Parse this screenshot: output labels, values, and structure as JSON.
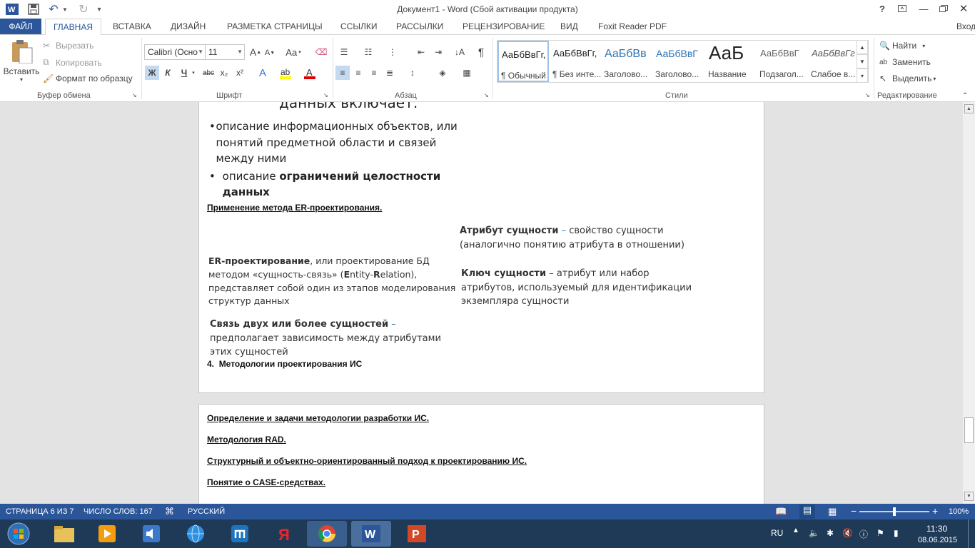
{
  "titlebar": {
    "title": "Документ1 - Word (Сбой активации продукта)",
    "help": "?",
    "user": "Вход"
  },
  "tabs": [
    "ФАЙЛ",
    "ГЛАВНАЯ",
    "ВСТАВКА",
    "ДИЗАЙН",
    "РАЗМЕТКА СТРАНИЦЫ",
    "ССЫЛКИ",
    "РАССЫЛКИ",
    "РЕЦЕНЗИРОВАНИЕ",
    "ВИД",
    "Foxit Reader PDF"
  ],
  "clipboard": {
    "paste": "Вставить",
    "cut": "Вырезать",
    "copy": "Копировать",
    "format_painter": "Формат по образцу",
    "group": "Буфер обмена"
  },
  "font": {
    "name": "Calibri (Осно",
    "size": "11",
    "group": "Шрифт",
    "bold": "Ж",
    "italic": "К",
    "underline": "Ч",
    "strike": "abc",
    "sub": "x₂",
    "sup": "x²",
    "case": "Аа"
  },
  "paragraph": {
    "group": "Абзац"
  },
  "styles": {
    "group": "Стили",
    "items": [
      {
        "preview": "АаБбВвГг,",
        "name": "¶ Обычный"
      },
      {
        "preview": "АаБбВвГг,",
        "name": "¶ Без инте..."
      },
      {
        "preview": "АаБбВв",
        "name": "Заголово..."
      },
      {
        "preview": "АаБбВвГ",
        "name": "Заголово..."
      },
      {
        "preview": "АаБ",
        "name": "Название"
      },
      {
        "preview": "АаБбВвГ",
        "name": "Подзагол..."
      },
      {
        "preview": "АаБбВвГг",
        "name": "Слабое в..."
      }
    ]
  },
  "editing": {
    "group": "Редактирование",
    "find": "Найти",
    "replace": "Заменить",
    "select": "Выделить"
  },
  "page1": {
    "heading_fragment": "данных включает:",
    "bullet1": "описание информационных объектов, или понятий предметной области и связей между ними",
    "bullet2_normal": "описание ",
    "bullet2_bold": "ограничений целостности данных",
    "link_er": "Применение метода ER-проектирования.",
    "attr_bold": "Атрибут сущности",
    "attr_dash": " – ",
    "attr_text": "свойство сущности (аналогично понятию атрибута в отношении)",
    "er_bold": "ER-проектирование",
    "er_text1": ", или проектирование БД методом «сущность-связь» (",
    "er_E": "E",
    "er_ntity": "ntity-",
    "er_R": "R",
    "er_text2": "elation), представляет собой один из этапов моделирования структур данных",
    "key_bold": "Ключ сущности",
    "key_text": " – атрибут или набор атрибутов, используемый для идентификации экземпляра сущности",
    "rel_bold": "Связь двух или более сущностей",
    "rel_dash": " – ",
    "rel_text": "предполагает зависимость между атрибутами этих сущностей",
    "section_num": "4.",
    "section_title": "Методологии проектирования ИС"
  },
  "page2": {
    "links": [
      "Определение и задачи методологии разработки ИС.",
      "Методология RAD.",
      "Структурный и объектно-ориентированный подход к проектированию ИС.",
      "Понятие о CASE-средствах."
    ]
  },
  "status": {
    "page": "СТРАНИЦА 6 ИЗ 7",
    "words": "ЧИСЛО СЛОВ: 167",
    "language": "РУССКИЙ",
    "zoom": "100%",
    "zoom_level_percent": 100
  },
  "taskbar": {
    "lang": "RU",
    "time": "11:30",
    "date": "08.06.2015"
  },
  "colors": {
    "accent": "#2b579a",
    "taskbar": "#1f3a57",
    "dash_blue": "#2e74b5"
  }
}
